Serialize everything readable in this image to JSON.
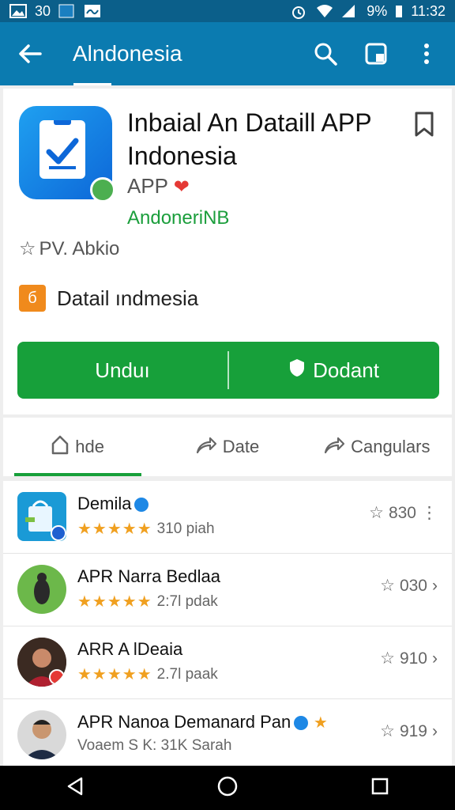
{
  "status_bar": {
    "left_text": "30",
    "time": "11:32",
    "battery": "9%"
  },
  "app_bar": {
    "title": "Alndonesia"
  },
  "app": {
    "name": "Inbaial An Dataill APP Indonesia",
    "type": "APP",
    "developer": "AndoneriNB",
    "rating_text": "PV. Abkio",
    "detail_text": "Datail ındmesia",
    "buttons": {
      "primary": "Unduı",
      "secondary": "Dodant"
    }
  },
  "tabs": [
    {
      "label": "hde"
    },
    {
      "label": "Date"
    },
    {
      "label": "Cangulars"
    }
  ],
  "list": [
    {
      "name": "Demila",
      "sub": "310 piah",
      "score": "830",
      "stars": "★★★★★"
    },
    {
      "name": "APR Narra Bedlaa",
      "sub": "2:7l pdak",
      "score": "030",
      "stars": "★★★★★"
    },
    {
      "name": "ARR A lDeaia",
      "sub": "2.7l paak",
      "score": "910",
      "stars": "★★★★★"
    },
    {
      "name": "APR Nanoa Demanard Pan",
      "sub": "Voaem S K: 31K Sarah",
      "score": "919",
      "stars": ""
    }
  ],
  "colors": {
    "app_bar": "#0b7bb0",
    "status_bar": "#0b5f8a",
    "accent_green": "#17a03a",
    "star": "#f0a020"
  }
}
